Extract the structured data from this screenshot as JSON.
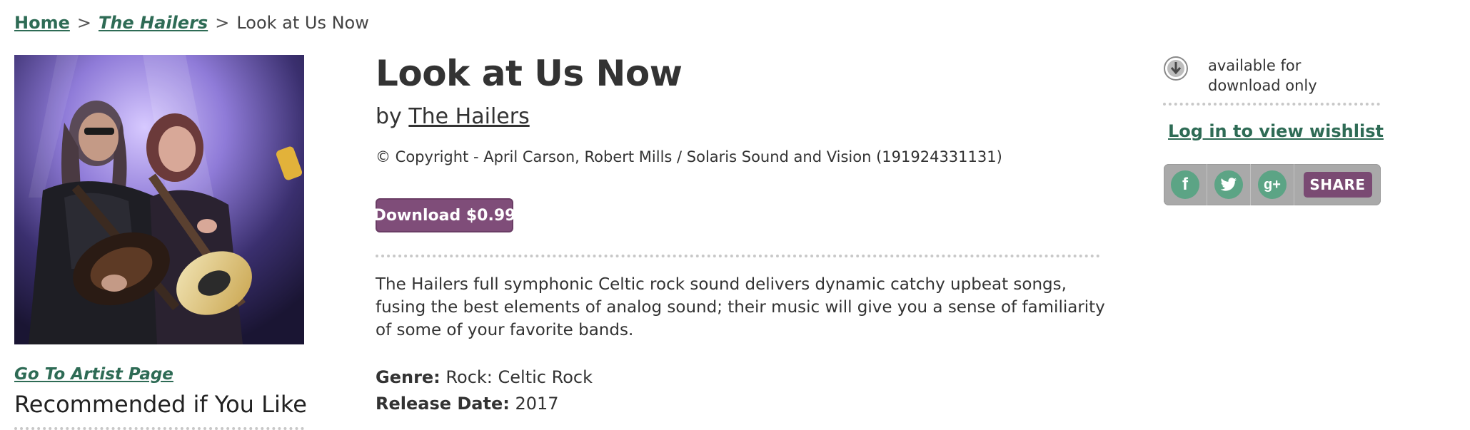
{
  "breadcrumb": {
    "home": "Home",
    "artist": "The Hailers",
    "separator": ">",
    "current": "Look at Us Now"
  },
  "album": {
    "title": "Look at Us Now",
    "by_prefix": "by",
    "artist": "The Hailers",
    "copyright": "© Copyright - April Carson, Robert Mills / Solaris Sound and Vision (191924331131)"
  },
  "download_button": "Download $0.99",
  "description": "The Hailers full symphonic Celtic rock sound delivers dynamic catchy upbeat songs, fusing the best elements of analog sound; their music will give you a sense of familiarity of some of your favorite bands.",
  "meta": {
    "genre_label": "Genre:",
    "genre_value": "Rock: Celtic Rock",
    "release_label": "Release Date:",
    "release_value": "2017"
  },
  "sidebar": {
    "artist_page_link": "Go To Artist Page",
    "recommended_heading": "Recommended if You Like"
  },
  "right_panel": {
    "availability": "available for download only",
    "wishlist_link": "Log in to view wishlist",
    "share_label": "SHARE",
    "social_icons": [
      "facebook-icon",
      "twitter-icon",
      "google-plus-icon"
    ],
    "icon_glyphs": {
      "facebook": "f",
      "twitter": "t",
      "google_plus": "g+"
    }
  },
  "colors": {
    "link_green": "#2e6b55",
    "button_purple": "#7f4d79",
    "social_green": "#5ca485",
    "share_bar_gray": "#a9a9a9"
  }
}
